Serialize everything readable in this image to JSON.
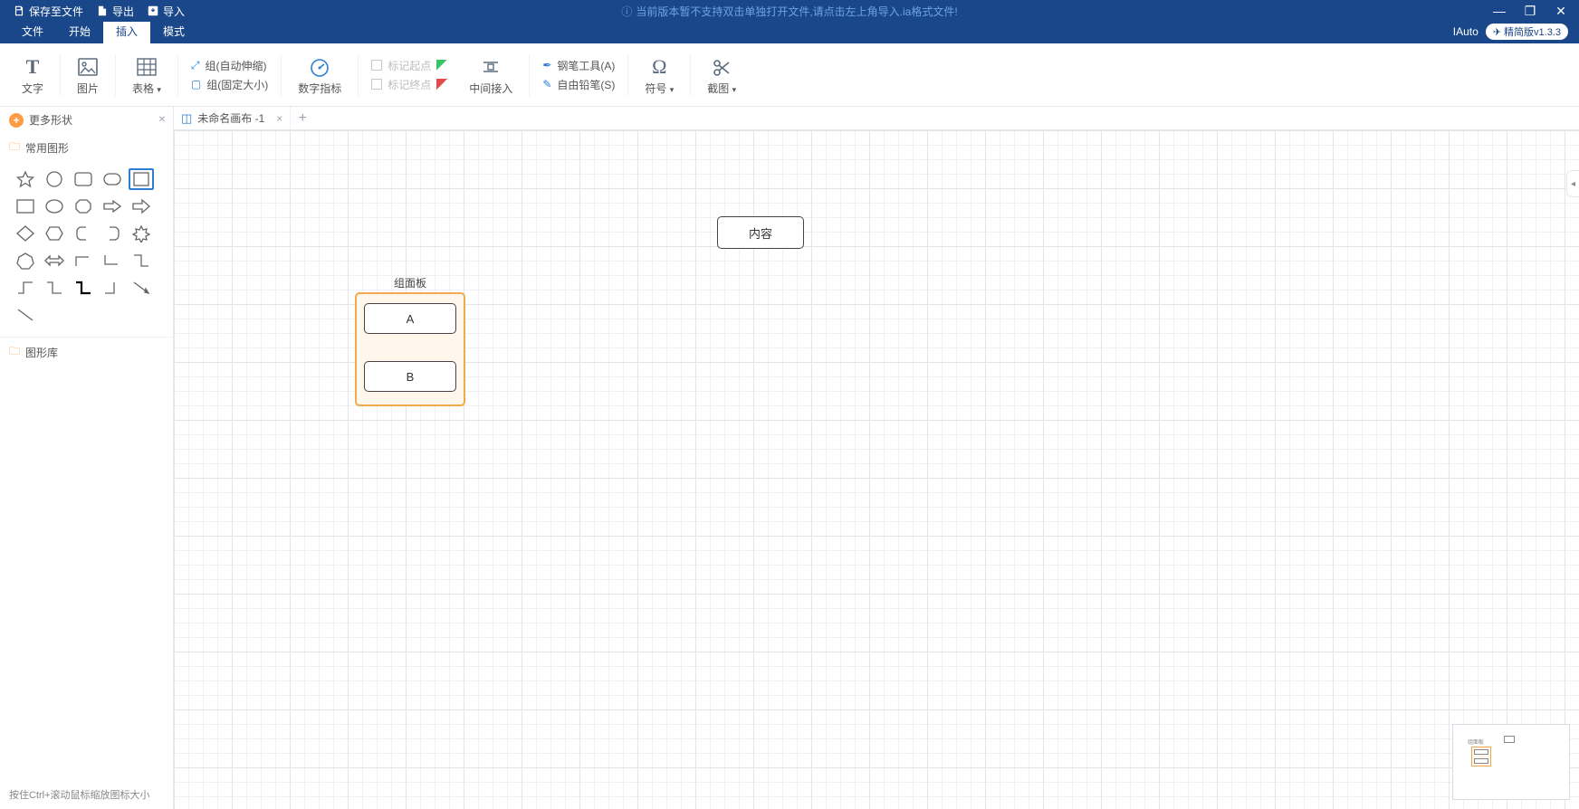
{
  "titlebar": {
    "save": "保存至文件",
    "export": "导出",
    "import": "导入",
    "notice": "当前版本暂不支持双击单独打开文件,请点击左上角导入.ia格式文件!",
    "brand": "IAuto",
    "version": "精简版v1.3.3"
  },
  "menubar": {
    "tabs": [
      "文件",
      "开始",
      "插入",
      "模式"
    ],
    "active_index": 2
  },
  "ribbon": {
    "text": "文字",
    "image": "图片",
    "table": "表格",
    "group_auto": "组(自动伸缩)",
    "group_fixed": "组(固定大小)",
    "digit_indicator": "数字指标",
    "mark_start": "标记起点",
    "mark_end": "标记终点",
    "middle_insert": "中间接入",
    "pen_tool": "钢笔工具(A)",
    "free_pencil": "自由铅笔(S)",
    "symbol": "符号",
    "screenshot": "截图"
  },
  "sidebar": {
    "more_shapes": "更多形状",
    "common_shapes": "常用图形",
    "shape_library": "图形库",
    "hint": "按住Ctrl+滚动鼠标缩放图标大小"
  },
  "tabs": {
    "doc1": "未命名画布 -1"
  },
  "canvas": {
    "group_title": "组面板",
    "box_a": "A",
    "box_b": "B",
    "content_box": "内容"
  }
}
